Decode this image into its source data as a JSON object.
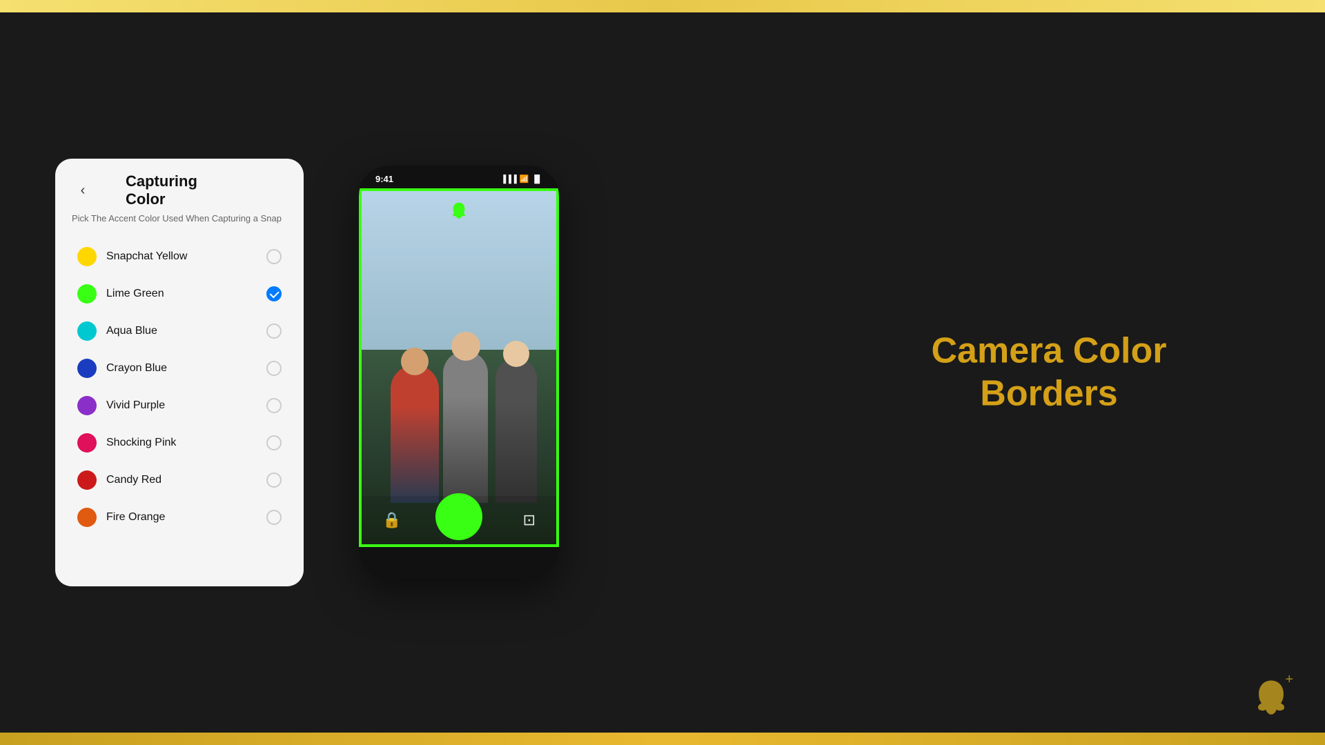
{
  "page": {
    "background_color": "#1a1a1a",
    "top_border_color": "#f5e070",
    "bottom_border_color": "#c8a020"
  },
  "settings_panel": {
    "title": "Capturing Color",
    "subtitle": "Pick The Accent Color Used When Capturing a Snap",
    "back_label": "‹",
    "colors": [
      {
        "id": "snapchat-yellow",
        "label": "Snapchat Yellow",
        "color": "#FFD700",
        "selected": false
      },
      {
        "id": "lime-green",
        "label": "Lime Green",
        "color": "#39FF14",
        "selected": true
      },
      {
        "id": "aqua-blue",
        "label": "Aqua Blue",
        "color": "#00C8D0",
        "selected": false
      },
      {
        "id": "crayon-blue",
        "label": "Crayon Blue",
        "color": "#1a3dbf",
        "selected": false
      },
      {
        "id": "vivid-purple",
        "label": "Vivid Purple",
        "color": "#8b2fc9",
        "selected": false
      },
      {
        "id": "shocking-pink",
        "label": "Shocking Pink",
        "color": "#e0105a",
        "selected": false
      },
      {
        "id": "candy-red",
        "label": "Candy Red",
        "color": "#cc1a1a",
        "selected": false
      },
      {
        "id": "fire-orange",
        "label": "Fire Orange",
        "color": "#e05a10",
        "selected": false
      }
    ]
  },
  "phone": {
    "time": "9:41",
    "border_color": "#39FF14",
    "capture_btn_color": "#39FF14",
    "ghost_color": "#39FF14"
  },
  "feature_title": "Camera Color Borders",
  "snapchat_icon": "👻"
}
